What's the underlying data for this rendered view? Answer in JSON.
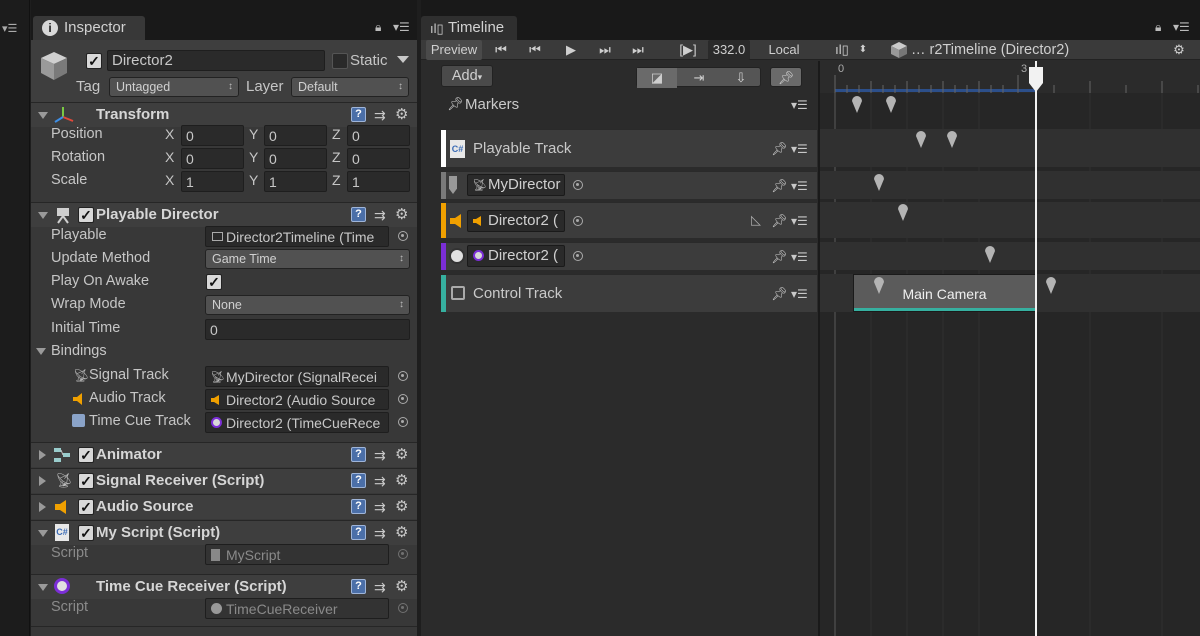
{
  "inspector": {
    "tab_label": "Inspector",
    "object_name": "Director2",
    "static_label": "Static",
    "tag_label": "Tag",
    "tag_value": "Untagged",
    "layer_label": "Layer",
    "layer_value": "Default",
    "transform": {
      "title": "Transform",
      "position": {
        "label": "Position",
        "x": "0",
        "y": "0",
        "z": "0"
      },
      "rotation": {
        "label": "Rotation",
        "x": "0",
        "y": "0",
        "z": "0"
      },
      "scale": {
        "label": "Scale",
        "x": "1",
        "y": "1",
        "z": "1"
      },
      "axis_x": "X",
      "axis_y": "Y",
      "axis_z": "Z"
    },
    "playable_director": {
      "title": "Playable Director",
      "playable_label": "Playable",
      "playable_value": "Director2Timeline (Time",
      "update_method_label": "Update Method",
      "update_method_value": "Game Time",
      "play_on_awake_label": "Play On Awake",
      "wrap_mode_label": "Wrap Mode",
      "wrap_mode_value": "None",
      "initial_time_label": "Initial Time",
      "initial_time_value": "0",
      "bindings_label": "Bindings",
      "bindings": [
        {
          "label": "Signal Track",
          "value": "MyDirector (SignalRecei"
        },
        {
          "label": "Audio Track",
          "value": "Director2 (Audio Source"
        },
        {
          "label": "Time Cue Track",
          "value": "Director2 (TimeCueRece"
        }
      ]
    },
    "components": [
      {
        "title": "Animator"
      },
      {
        "title": "Signal Receiver (Script)"
      },
      {
        "title": "Audio Source"
      },
      {
        "title": "My Script (Script)"
      },
      {
        "title": "Time Cue Receiver (Script)"
      }
    ],
    "my_script_field": {
      "label": "Script",
      "value": "MyScript"
    },
    "time_cue_field": {
      "label": "Script",
      "value": "TimeCueReceiver"
    }
  },
  "timeline": {
    "tab_label": "Timeline",
    "preview_label": "Preview",
    "frame_value": "332.0",
    "local_label": "Local",
    "breadcrumb": "… r2Timeline (Director2)",
    "add_label": "Add",
    "markers_label": "Markers",
    "ruler_start": "0",
    "ruler_playhead": "3",
    "tracks": [
      {
        "label": "Playable Track",
        "color": "#ffffff"
      },
      {
        "label": "MyDirector",
        "color": "#7a7a7a"
      },
      {
        "label": "Director2 (",
        "color": "#f0a000"
      },
      {
        "label": "Director2 (",
        "color": "#7b2ed6"
      },
      {
        "label": "Control Track",
        "color": "#36b0a0"
      }
    ],
    "clip_label": "Main Camera"
  },
  "colors": {
    "accent_blue": "#4b6fa8",
    "audio_orange": "#f0a000",
    "timecue_purple": "#7b2ed6",
    "control_teal": "#36b0a0"
  }
}
